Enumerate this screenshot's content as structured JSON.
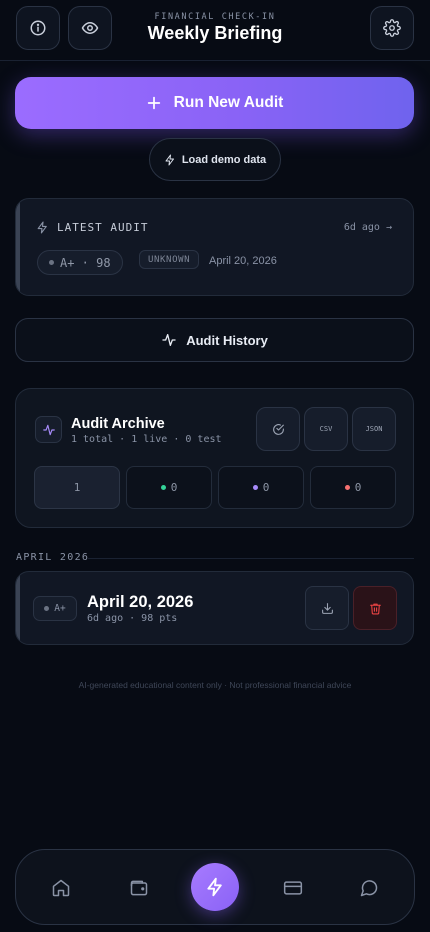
{
  "header": {
    "eyebrow": "FINANCIAL CHECK-IN",
    "title": "Weekly Briefing",
    "icons": [
      "info-icon",
      "eye-icon",
      "gear-icon"
    ]
  },
  "actions": {
    "run_label": "Run New Audit",
    "demo_label": "Load demo data"
  },
  "latest_audit": {
    "label": "LATEST AUDIT",
    "ago": "6d ago →",
    "grade": "A+",
    "score_text": "A+ · 98",
    "status": "UNKNOWN",
    "date": "April 20, 2026"
  },
  "history": {
    "label": "Audit History"
  },
  "archive": {
    "title": "Audit Archive",
    "subtitle": "1 total · 1 live · 0 test",
    "buttons": {
      "csv": "CSV",
      "json": "JSON"
    },
    "stats": [
      {
        "value": "1",
        "color": ""
      },
      {
        "value": "0",
        "color": "#34d399"
      },
      {
        "value": "0",
        "color": "#a78bfa"
      },
      {
        "value": "0",
        "color": "#f87171"
      }
    ]
  },
  "month": {
    "label": "APRIL 2026"
  },
  "entries": [
    {
      "grade": "A+",
      "title": "April 20, 2026",
      "subtitle": "6d ago · 98 pts"
    }
  ],
  "disclaimer": "AI-generated educational content only · Not professional financial advice",
  "nav": {
    "items": [
      "home-icon",
      "wallet-icon",
      "lightning-icon",
      "card-icon",
      "chat-icon"
    ]
  },
  "colors": {
    "accent": "#8b5cf6",
    "danger": "#ef4444",
    "background": "#070b14"
  }
}
